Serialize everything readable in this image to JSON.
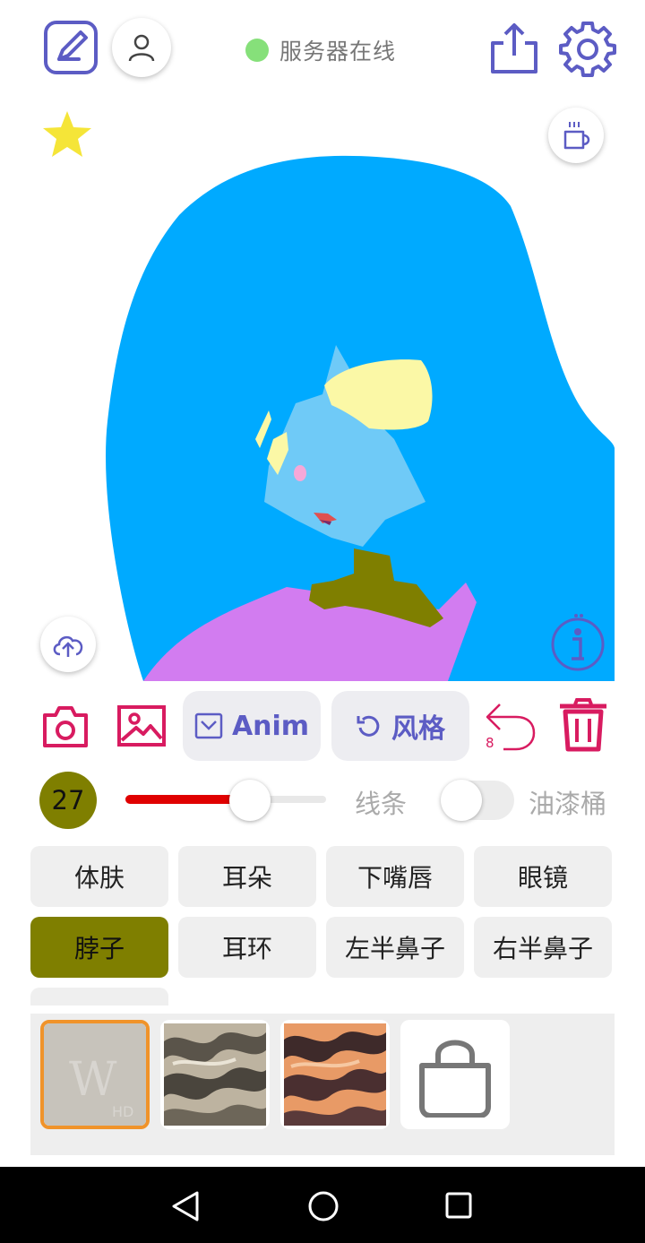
{
  "status": {
    "text": "服务器在线",
    "dot_color": "#86e07a"
  },
  "icons": {
    "edit": "edit-icon",
    "profile": "user-icon",
    "share": "share-icon",
    "settings": "gear-icon",
    "favorite": "star-icon",
    "coffee": "coffee-icon",
    "upload": "cloud-upload-icon",
    "info": "info-icon",
    "camera": "camera-icon",
    "gallery": "image-icon",
    "undo": "undo-icon",
    "delete": "trash-icon",
    "shop": "shopping-bag-icon"
  },
  "toolbar": {
    "anim_label": "Anim",
    "style_label": "风格",
    "undo_count": "8"
  },
  "brush": {
    "size": "27",
    "size_color": "#7f7f00",
    "slider_value": 0.62,
    "slider_color": "#e00000",
    "line_label": "线条",
    "bucket_label": "油漆桶",
    "bucket_on": false
  },
  "parts": [
    {
      "label": "体肤",
      "active": false
    },
    {
      "label": "耳朵",
      "active": false
    },
    {
      "label": "下嘴唇",
      "active": false
    },
    {
      "label": "眼镜",
      "active": false
    },
    {
      "label": "脖子",
      "active": true
    },
    {
      "label": "耳环",
      "active": false
    },
    {
      "label": "左半鼻子",
      "active": false
    },
    {
      "label": "右半鼻子",
      "active": false
    }
  ],
  "textures": [
    {
      "name": "hd-watermark-texture",
      "logo": "W",
      "tag": "HD",
      "selected": true
    },
    {
      "name": "silver-texture",
      "selected": false
    },
    {
      "name": "copper-texture",
      "selected": false
    }
  ],
  "colors": {
    "accent": "#5c5cc4",
    "danger": "#d81b60",
    "hair": "#00aaff",
    "skin": "#6fcaf7",
    "hair_light": "#fbf8a6",
    "neck": "#7f7f00",
    "shirt": "#d27cf0"
  }
}
